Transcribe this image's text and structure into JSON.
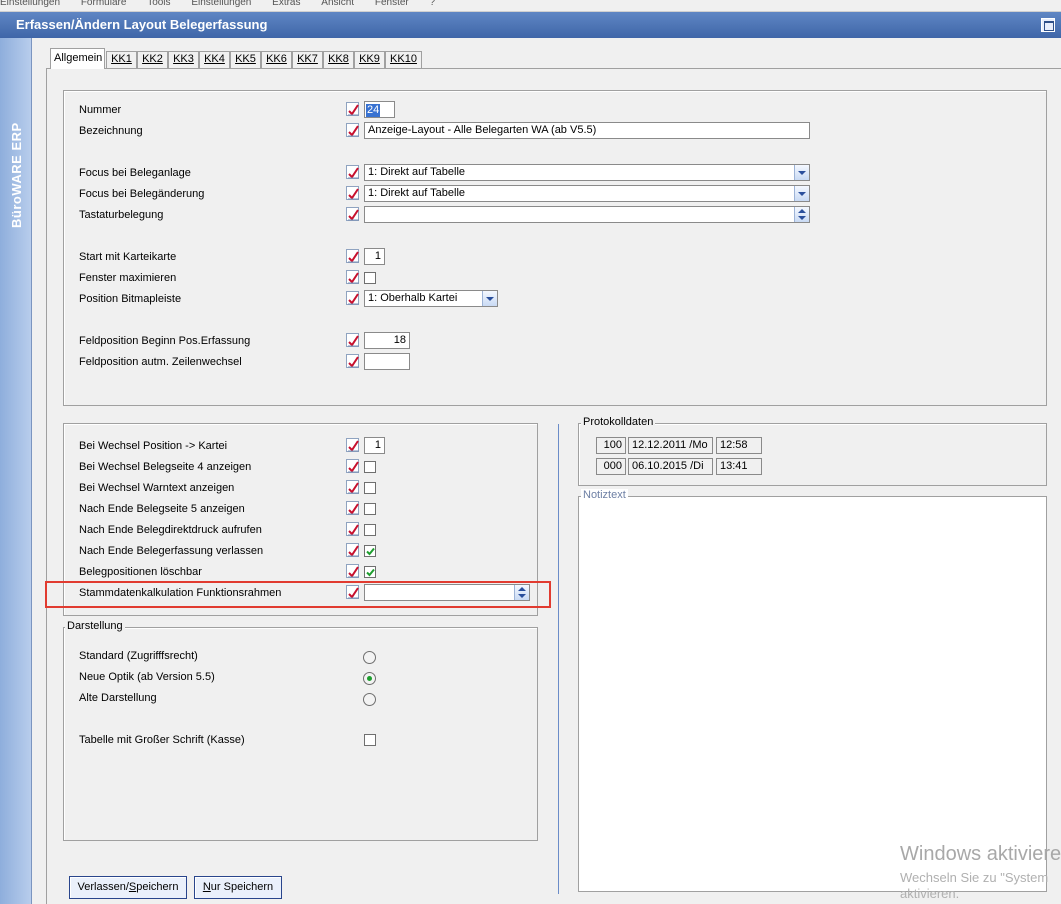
{
  "menu": [
    "Einstellungen",
    "Formulare",
    "Tools",
    "Einstellungen",
    "Extras",
    "Ansicht",
    "Fenster",
    "?"
  ],
  "window": {
    "title": "Erfassen/Ändern Layout Belegerfassung"
  },
  "sidebar": {
    "brand": "BüroWARE ERP"
  },
  "tabs": [
    "Allgemein",
    "KK1",
    "KK2",
    "KK3",
    "KK4",
    "KK5",
    "KK6",
    "KK7",
    "KK8",
    "KK9",
    "KK10"
  ],
  "active_tab": "Allgemein",
  "general": {
    "nummer": {
      "label": "Nummer",
      "value": "24"
    },
    "bezeichnung": {
      "label": "Bezeichnung",
      "value": "Anzeige-Layout - Alle Belegarten WA (ab V5.5)"
    },
    "focus_anlage": {
      "label": "Focus bei Beleganlage",
      "value": "1: Direkt auf Tabelle"
    },
    "focus_aenderung": {
      "label": "Focus bei Belegänderung",
      "value": "1: Direkt auf Tabelle"
    },
    "tastatur": {
      "label": "Tastaturbelegung",
      "value": ""
    },
    "start_karteikarte": {
      "label": "Start mit Karteikarte",
      "value": "1"
    },
    "fenster_max": {
      "label": "Fenster maximieren",
      "checked": false
    },
    "bitmapleiste": {
      "label": "Position Bitmapleiste",
      "value": "1: Oberhalb Kartei"
    },
    "feldpos_beginn": {
      "label": "Feldposition Beginn Pos.Erfassung",
      "value": "18"
    },
    "feldpos_zeile": {
      "label": "Feldposition autm. Zeilenwechsel",
      "value": ""
    }
  },
  "options": {
    "wechsel_kartei": {
      "label": "Bei Wechsel Position -> Kartei",
      "value": "1"
    },
    "items": [
      {
        "label": "Bei Wechsel Belegseite 4 anzeigen",
        "checked": false
      },
      {
        "label": "Bei Wechsel Warntext anzeigen",
        "checked": false
      },
      {
        "label": "Nach Ende Belegseite 5 anzeigen",
        "checked": false
      },
      {
        "label": "Nach Ende Belegdirektdruck aufrufen",
        "checked": false
      },
      {
        "label": "Nach Ende Belegerfassung verlassen",
        "checked": true
      },
      {
        "label": "Belegpositionen löschbar",
        "checked": true
      }
    ],
    "stammdaten": {
      "label": "Stammdatenkalkulation Funktionsrahmen",
      "value": ""
    }
  },
  "darstellung": {
    "title": "Darstellung",
    "radios": [
      {
        "label": "Standard (Zugrifffsrecht)",
        "selected": false
      },
      {
        "label": "Neue Optik (ab Version 5.5)",
        "selected": true
      },
      {
        "label": "Alte Darstellung",
        "selected": false
      }
    ],
    "grosse_schrift": {
      "label": "Tabelle mit Großer Schrift (Kasse)",
      "checked": false
    }
  },
  "protokoll": {
    "title": "Protokolldaten",
    "rows": [
      {
        "nr": "100",
        "date": "12.12.2011 /Mo",
        "time": "12:58"
      },
      {
        "nr": "000",
        "date": "06.10.2015 /Di",
        "time": "13:41"
      }
    ]
  },
  "notiz": {
    "title": "Notiztext",
    "value": ""
  },
  "buttons": {
    "verlassen": {
      "pre": "Verlassen/",
      "ul": "S",
      "post": "peichern"
    },
    "nur": {
      "pre": "",
      "ul": "N",
      "post": "ur Speichern"
    }
  },
  "watermark": {
    "line1": "Windows aktiviere",
    "line2": "Wechseln Sie zu \"System",
    "line3": "aktivieren."
  },
  "colors": {
    "title_bar": "#4a72b5",
    "sidebar": "#9fbbe4",
    "highlight_border": "#e13b30",
    "check_green": "#1e9e2e",
    "edit_icon_red": "#c8102e"
  }
}
